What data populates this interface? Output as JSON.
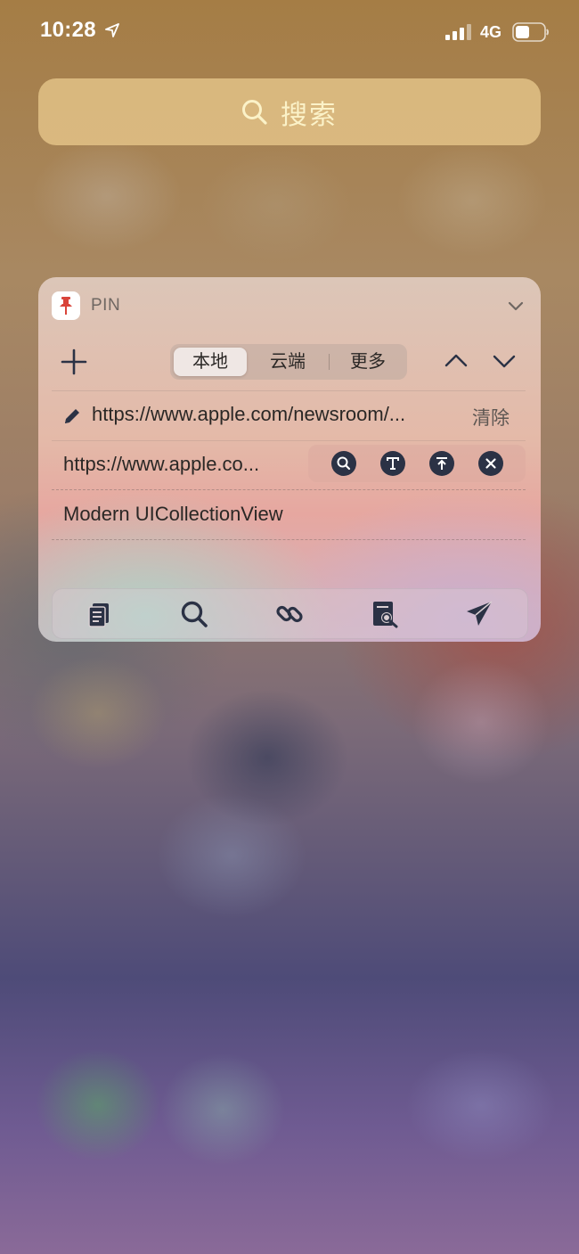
{
  "status_bar": {
    "time": "10:28",
    "network": "4G"
  },
  "search": {
    "label": "搜索"
  },
  "widget": {
    "app_name": "PIN",
    "tabs": [
      {
        "label": "本地",
        "active": true
      },
      {
        "label": "云端",
        "active": false
      },
      {
        "label": "更多",
        "active": false
      }
    ],
    "edit_row": {
      "url": "https://www.apple.com/newsroom/...",
      "clear_label": "清除"
    },
    "items": [
      {
        "text": "https://www.apple.co..."
      },
      {
        "text": "Modern UICollectionView"
      }
    ],
    "item_actions": [
      "search-icon",
      "text-icon",
      "pin-top-icon",
      "close-icon"
    ],
    "toolbar": [
      "copy-icon",
      "search-icon",
      "link-icon",
      "doc-search-icon",
      "send-icon"
    ]
  },
  "colors": {
    "icon_dark": "#2b3245",
    "search_text": "#fbf2c8"
  }
}
